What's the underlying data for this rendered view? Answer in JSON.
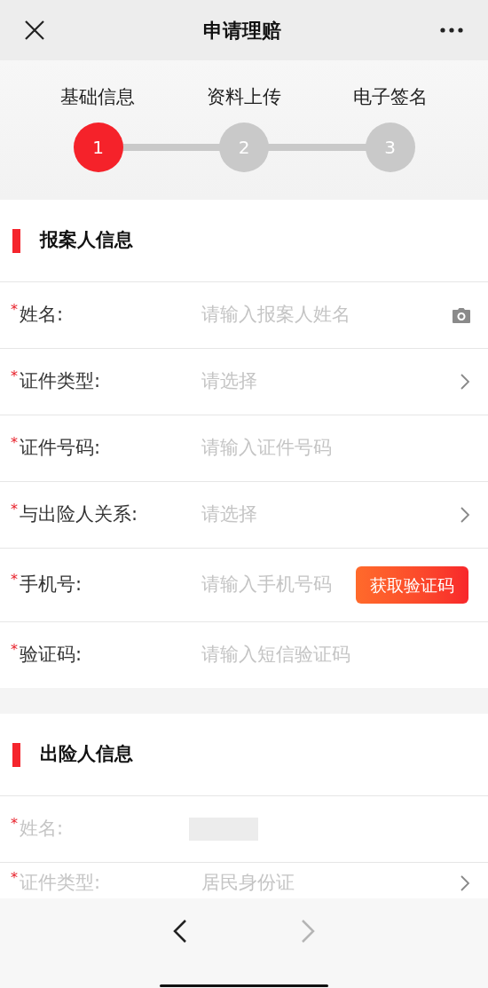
{
  "header": {
    "title": "申请理赔"
  },
  "steps": [
    {
      "label": "基础信息",
      "number": "1",
      "selected": true
    },
    {
      "label": "资料上传",
      "number": "2",
      "selected": false
    },
    {
      "label": "电子签名",
      "number": "3",
      "selected": false
    }
  ],
  "sections": [
    {
      "title": "报案人信息",
      "rows": [
        {
          "kind": "camera",
          "mark": "*",
          "label": "姓名:",
          "disabled": false,
          "placeholder": "请输入报案人姓名"
        },
        {
          "kind": "select",
          "mark": "*",
          "label": "证件类型:",
          "disabled": false,
          "placeholder": "请选择"
        },
        {
          "kind": "text",
          "mark": "*",
          "label": "证件号码:",
          "disabled": false,
          "placeholder": "请输入证件号码"
        },
        {
          "kind": "select",
          "mark": "*",
          "label": "与出险人关系:",
          "disabled": false,
          "placeholder": "请选择"
        },
        {
          "kind": "sms",
          "mark": "*",
          "label": "手机号:",
          "disabled": false,
          "placeholder": "请输入手机号码",
          "button": "获取验证码"
        },
        {
          "kind": "text",
          "mark": "*",
          "label": "验证码:",
          "disabled": false,
          "placeholder": "请输入短信验证码"
        }
      ]
    },
    {
      "title": "出险人信息",
      "rows": [
        {
          "kind": "redacted",
          "mark": "*",
          "label": "姓名:",
          "disabled": true
        },
        {
          "kind": "select",
          "mark": "*",
          "label": "证件类型:",
          "disabled": true,
          "value": "居民身份证"
        }
      ]
    }
  ],
  "nav": {
    "prev_disabled": false,
    "next_disabled": true
  }
}
